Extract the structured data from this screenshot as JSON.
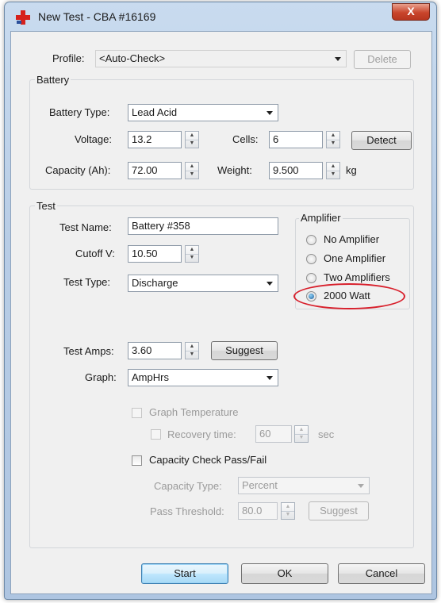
{
  "window": {
    "title": "New Test - CBA #16169",
    "close_label": "X"
  },
  "profile": {
    "label": "Profile:",
    "value": "<Auto-Check>",
    "delete_label": "Delete"
  },
  "battery": {
    "group_title": "Battery",
    "type_label": "Battery Type:",
    "type_value": "Lead Acid",
    "voltage_label": "Voltage:",
    "voltage_value": "13.2",
    "cells_label": "Cells:",
    "cells_value": "6",
    "detect_label": "Detect",
    "capacity_label": "Capacity (Ah):",
    "capacity_value": "72.00",
    "weight_label": "Weight:",
    "weight_value": "9.500",
    "weight_unit": "kg"
  },
  "test": {
    "group_title": "Test",
    "name_label": "Test Name:",
    "name_value": "Battery #358",
    "cutoff_label": "Cutoff V:",
    "cutoff_value": "10.50",
    "type_label": "Test Type:",
    "type_value": "Discharge",
    "amps_label": "Test Amps:",
    "amps_value": "3.60",
    "amps_suggest_label": "Suggest",
    "graph_label": "Graph:",
    "graph_value": "AmpHrs",
    "graph_temperature_label": "Graph Temperature",
    "recovery_label": "Recovery time:",
    "recovery_value": "60",
    "recovery_unit": "sec",
    "capacity_check_label": "Capacity Check Pass/Fail",
    "capacity_type_label": "Capacity Type:",
    "capacity_type_value": "Percent",
    "pass_threshold_label": "Pass Threshold:",
    "pass_threshold_value": "80.0",
    "pass_suggest_label": "Suggest"
  },
  "amplifier": {
    "group_title": "Amplifier",
    "options": [
      {
        "label": "No Amplifier",
        "selected": false
      },
      {
        "label": "One Amplifier",
        "selected": false
      },
      {
        "label": "Two Amplifiers",
        "selected": false
      },
      {
        "label": "2000 Watt",
        "selected": true
      }
    ]
  },
  "footer": {
    "start_label": "Start",
    "ok_label": "OK",
    "cancel_label": "Cancel"
  },
  "colors": {
    "highlight_ring": "#d8202c",
    "title_bar": "#b8cde6",
    "dialog_bg": "#f0f0f0"
  }
}
